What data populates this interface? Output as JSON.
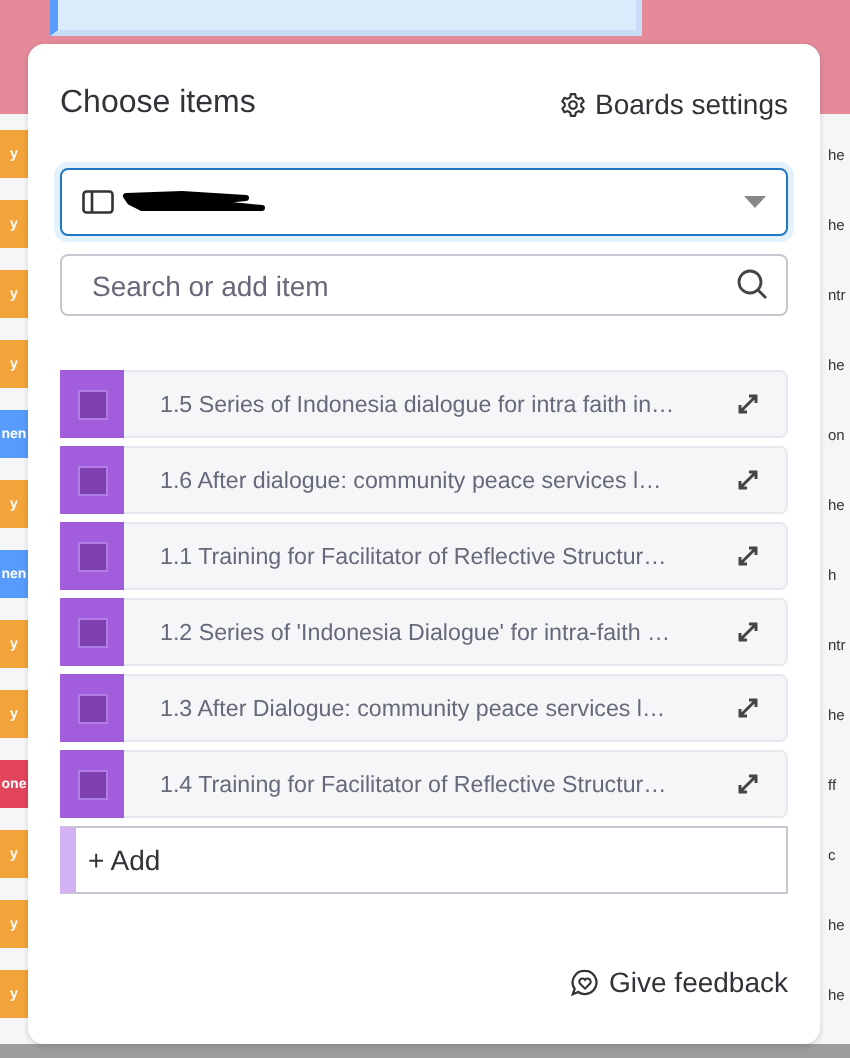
{
  "background": {
    "left_chips": [
      {
        "label": "y",
        "color": "#f2a33a"
      },
      {
        "label": "y",
        "color": "#f2a33a"
      },
      {
        "label": "y",
        "color": "#f2a33a"
      },
      {
        "label": "y",
        "color": "#f2a33a"
      },
      {
        "label": "nen",
        "color": "#579bfc"
      },
      {
        "label": "y",
        "color": "#f2a33a"
      },
      {
        "label": "nen",
        "color": "#579bfc"
      },
      {
        "label": "y",
        "color": "#f2a33a"
      },
      {
        "label": "y",
        "color": "#f2a33a"
      },
      {
        "label": "one",
        "color": "#e2445c"
      },
      {
        "label": "y",
        "color": "#f2a33a"
      },
      {
        "label": "y",
        "color": "#f2a33a"
      },
      {
        "label": "y",
        "color": "#f2a33a"
      }
    ],
    "right_cells": [
      "he",
      "he",
      "ntr",
      "he",
      "on",
      "he",
      "h",
      "ntr",
      "he",
      "ff",
      "c",
      "he",
      "he"
    ]
  },
  "dialog": {
    "title": "Choose items",
    "settings_button": "Boards settings",
    "search": {
      "placeholder": "Search or add item"
    },
    "items": [
      {
        "text": "1.5 Series of Indonesia dialogue for intra faith in…",
        "checked": false
      },
      {
        "text": "1.6 After dialogue: community peace services l…",
        "checked": false
      },
      {
        "text": "1.1 Training for Facilitator of Reflective Structur…",
        "checked": false
      },
      {
        "text": "1.2 Series of 'Indonesia Dialogue' for intra-faith …",
        "checked": false
      },
      {
        "text": "1.3 After Dialogue: community peace services l…",
        "checked": false
      },
      {
        "text": "1.4 Training for Facilitator of Reflective Structur…",
        "checked": false
      }
    ],
    "add_label": "+ Add",
    "feedback": "Give feedback"
  }
}
